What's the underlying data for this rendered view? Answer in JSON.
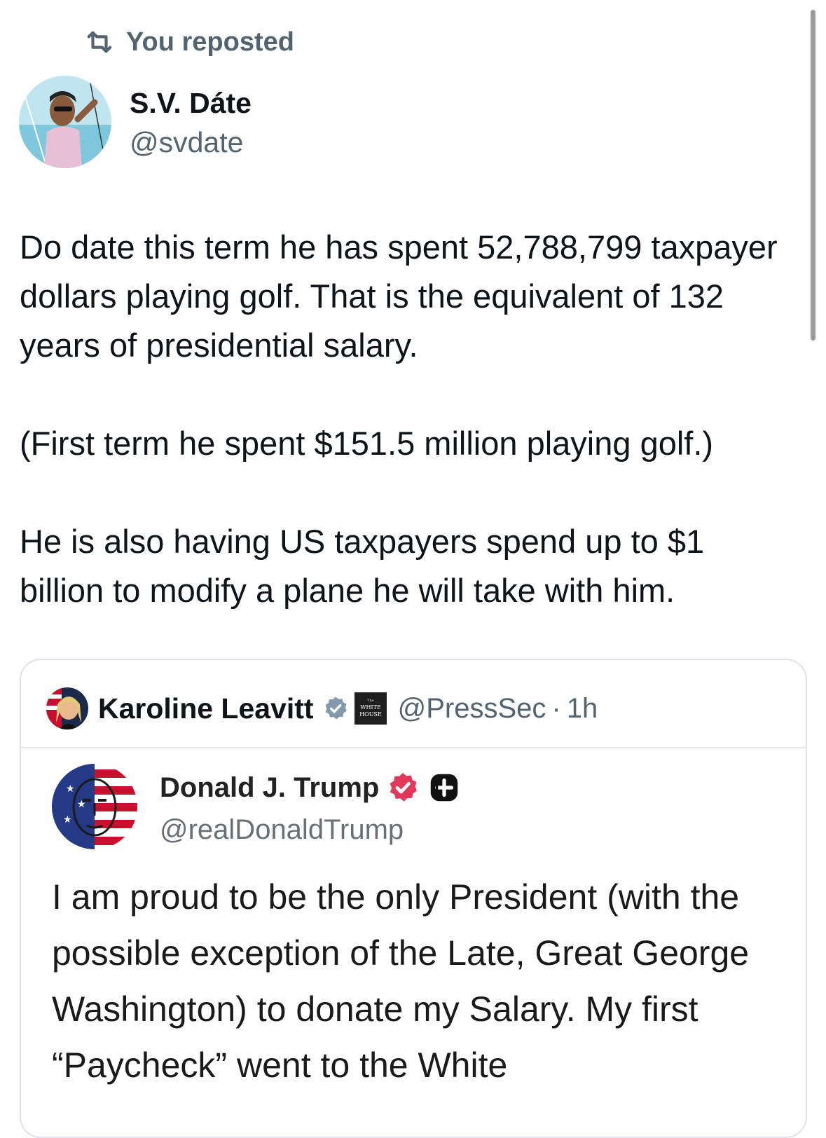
{
  "repost_banner": {
    "text": "You reposted",
    "icon": "repost-icon"
  },
  "post": {
    "author": {
      "name": "S.V. Dáte",
      "handle": "@svdate",
      "avatar": "avatar-photo"
    },
    "paragraphs": [
      "Do date this term he has spent 52,788,799 taxpayer dollars playing golf. That is the equivalent of 132 years of presidential salary.",
      "(First term he spent $151.5 million playing golf.)",
      "He is also having US taxpayers spend up to $1 billion to modify a plane he will take with him."
    ]
  },
  "quoted_post": {
    "author": {
      "name": "Karoline Leavitt",
      "badge": "verified-badge-icon",
      "affiliation_badge": "white-house-badge-icon",
      "handle": "@PressSec",
      "separator": "·",
      "time": "1h"
    },
    "embedded": {
      "name": "Donald J. Trump",
      "handle": "@realDonaldTrump",
      "badges": [
        "verified-badge-icon",
        "plus-badge-icon"
      ],
      "text": "I am proud to be the only President (with the possible exception of the Late, Great George Washington) to donate my Salary. My first “Paycheck” went to the White"
    }
  },
  "colors": {
    "text_primary": "#0f1419",
    "text_secondary": "#536471",
    "verified_blue": "#1d9bf0",
    "truth_verified_red": "#e0395b"
  }
}
